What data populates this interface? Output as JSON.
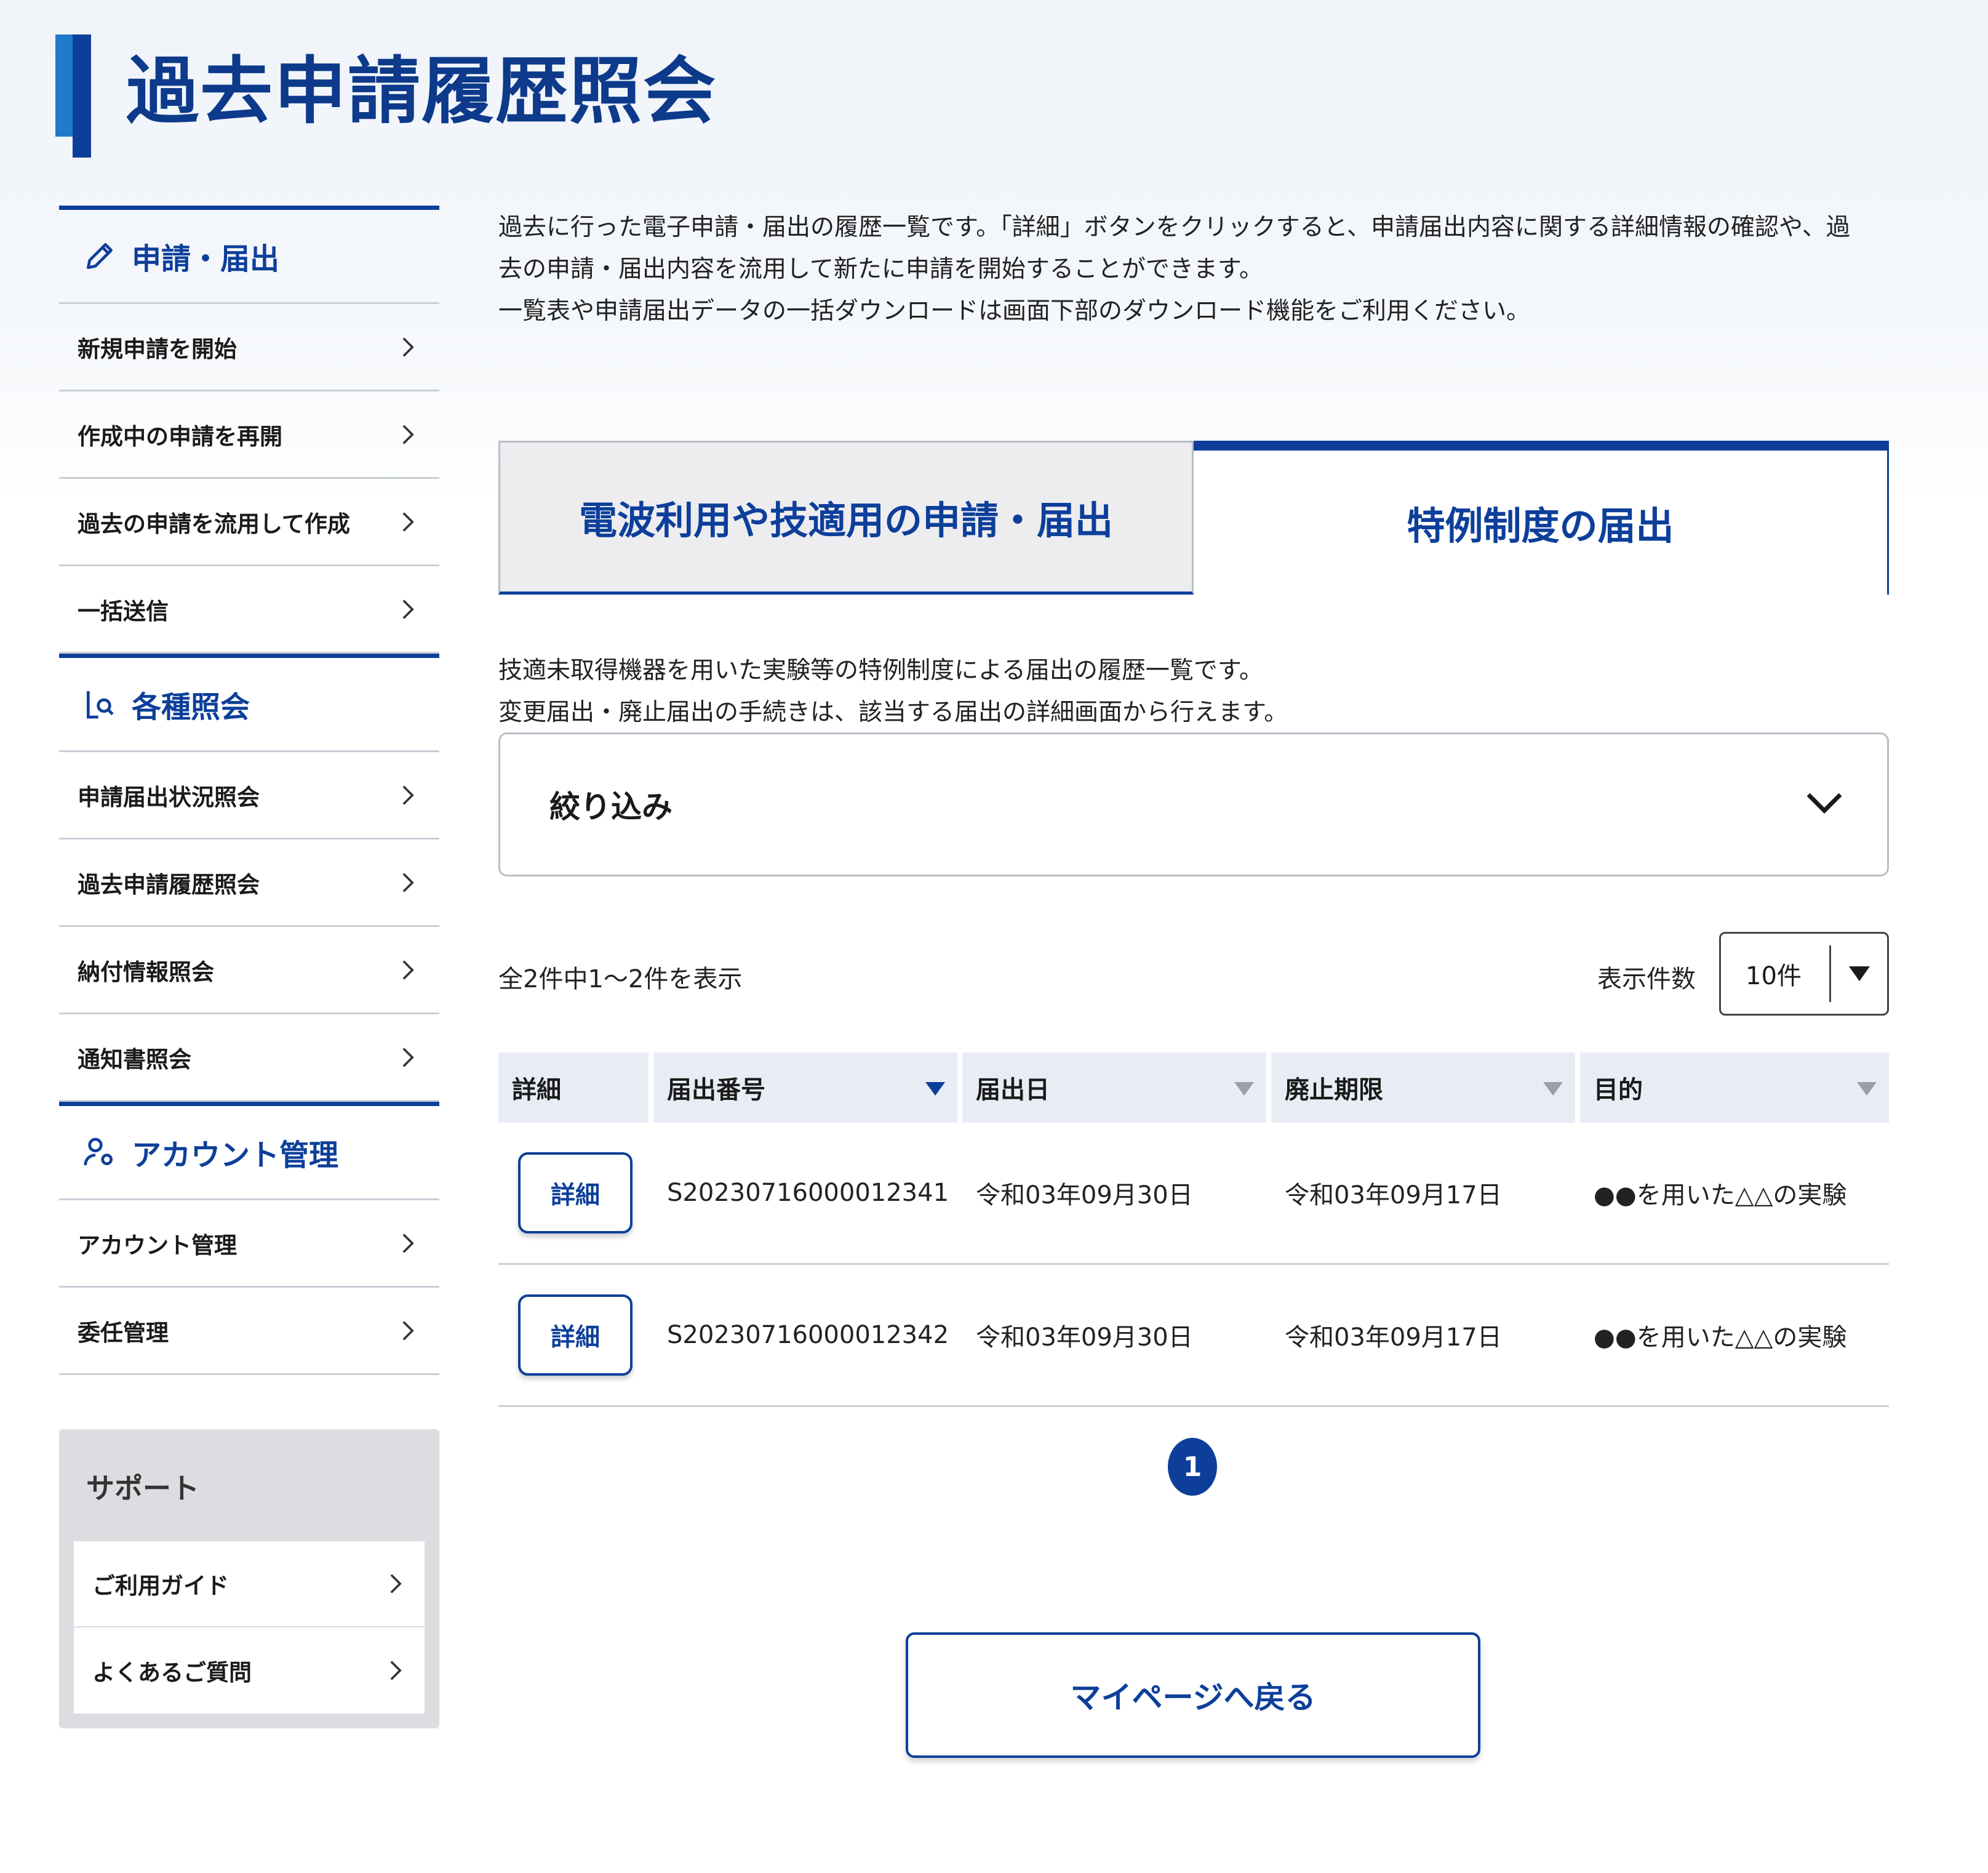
{
  "page": {
    "title": "過去申請履歴照会"
  },
  "sidebar": {
    "sections": [
      {
        "heading": "申請・届出",
        "icon": "pencil-icon",
        "items": [
          "新規申請を開始",
          "作成中の申請を再開",
          "過去の申請を流用して作成",
          "一括送信"
        ]
      },
      {
        "heading": "各種照会",
        "icon": "document-search-icon",
        "items": [
          "申請届出状況照会",
          "過去申請履歴照会",
          "納付情報照会",
          "通知書照会"
        ]
      },
      {
        "heading": "アカウント管理",
        "icon": "user-settings-icon",
        "items": [
          "アカウント管理",
          "委任管理"
        ]
      }
    ],
    "support": {
      "title": "サポート",
      "items": [
        "ご利用ガイド",
        "よくあるご質問"
      ]
    }
  },
  "intro": {
    "line1": "過去に行った電子申請・届出の履歴一覧です。「詳細」ボタンをクリックすると、申請届出内容に関する詳細情報の確認や、過",
    "line2": "去の申請・届出内容を流用して新たに申請を開始することができます。",
    "line3": "一覧表や申請届出データの一括ダウンロードは画面下部のダウンロード機能をご利用ください。"
  },
  "tabs": [
    {
      "label": "電波利用や技適用の申請・届出",
      "active": false
    },
    {
      "label": "特例制度の届出",
      "active": true
    }
  ],
  "description": {
    "line1": "技適未取得機器を用いた実験等の特例制度による届出の履歴一覧です。",
    "line2": "変更届出・廃止届出の手続きは、該当する届出の詳細画面から行えます。"
  },
  "filter": {
    "label": "絞り込み"
  },
  "listing": {
    "count_text": "全2件中1〜2件を表示",
    "per_page_label": "表示件数",
    "per_page_value": "10件"
  },
  "table": {
    "columns": [
      "詳細",
      "届出番号",
      "届出日",
      "廃止期限",
      "目的"
    ],
    "rows": [
      {
        "button": "詳細",
        "number": "S20230716000012341",
        "date": "令和03年09月30日",
        "deadline": "令和03年09月17日",
        "purpose": "●●を用いた△△の実験"
      },
      {
        "button": "詳細",
        "number": "S20230716000012342",
        "date": "令和03年09月30日",
        "deadline": "令和03年09月17日",
        "purpose": "●●を用いた△△の実験"
      }
    ]
  },
  "pagination": {
    "current": "1"
  },
  "back_button": {
    "label": "マイページへ戻る"
  },
  "colors": {
    "accent": "#0d3f9a",
    "accent_light": "#1f7ac9",
    "header_bg": "#e8edf5"
  }
}
